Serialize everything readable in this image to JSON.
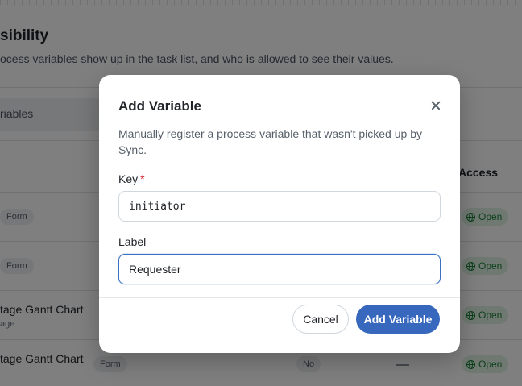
{
  "background": {
    "section_title": "sibility",
    "section_description": "ocess variables show up in the task list, and who is allowed to see their values.",
    "tab_label": "riables",
    "columns": {
      "access": "Access"
    },
    "rows": [
      {
        "name": "",
        "subtext": "",
        "type_chip": "Form",
        "access": "Open"
      },
      {
        "name": "",
        "subtext": "",
        "type_chip": "Form",
        "access": "Open"
      },
      {
        "name": "tage Gantt Chart",
        "subtext": "age",
        "type_chip": "",
        "access": "Open"
      },
      {
        "name": "tage Gantt Chart",
        "subtext": "",
        "type_chip": "Form",
        "visible": "No",
        "access": "Open"
      }
    ]
  },
  "modal": {
    "title": "Add Variable",
    "close_icon": "close-icon",
    "description": "Manually register a process variable that wasn't picked up by Sync.",
    "key_field": {
      "label": "Key",
      "required_marker": "*",
      "value": "initiator"
    },
    "label_field": {
      "label": "Label",
      "value": "Requester"
    },
    "cancel_label": "Cancel",
    "submit_label": "Add Variable"
  },
  "colors": {
    "primary": "#3868bd",
    "focus": "#3b6fc2",
    "open_badge_bg": "#dff3e4",
    "open_badge_text": "#1a7f37",
    "required": "#d1242f"
  }
}
